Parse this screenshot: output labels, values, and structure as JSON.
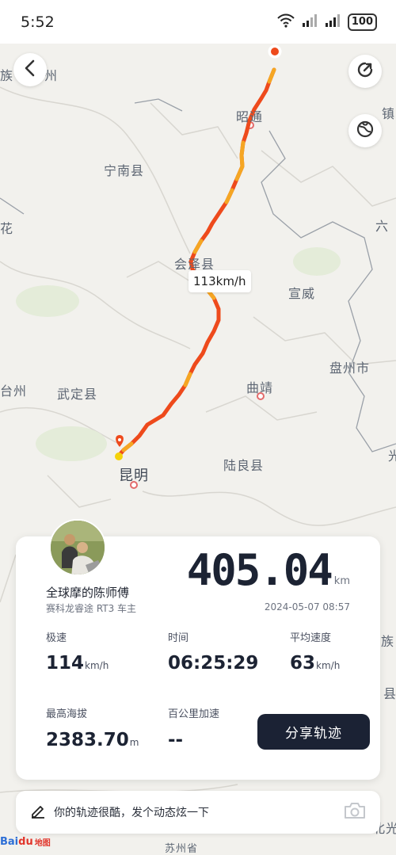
{
  "status_bar": {
    "time": "5:52",
    "battery": "100"
  },
  "map": {
    "labels": [
      {
        "id": "zhaotong",
        "text": "昭通"
      },
      {
        "id": "ningnan",
        "text": "宁南县"
      },
      {
        "id": "huize",
        "text": "会泽县"
      },
      {
        "id": "xuanwei",
        "text": "宣威"
      },
      {
        "id": "qujing",
        "text": "曲靖"
      },
      {
        "id": "panzhou",
        "text": "盘州市"
      },
      {
        "id": "wuding",
        "text": "武定县"
      },
      {
        "id": "kunming",
        "text": "昆明"
      },
      {
        "id": "luliang",
        "text": "陆良县"
      },
      {
        "id": "edge-zu",
        "text": "族"
      },
      {
        "id": "edge-zhou",
        "text": "州"
      },
      {
        "id": "edge-hua",
        "text": "花"
      },
      {
        "id": "edge-zhen",
        "text": "镇"
      },
      {
        "id": "edge-liu",
        "text": "六"
      },
      {
        "id": "edge-tai",
        "text": "台州"
      },
      {
        "id": "edge-guang",
        "text": "光"
      },
      {
        "id": "edge-zu2",
        "text": "族"
      },
      {
        "id": "edge-xian",
        "text": "县"
      },
      {
        "id": "edge-beiguang",
        "text": "北光"
      },
      {
        "id": "edge-suzhou",
        "text": "苏州省"
      }
    ],
    "speed_tag": "113km/h",
    "route_color": "#ee4a1c",
    "route_highlight_color": "#f5a623"
  },
  "card": {
    "user_name": "全球摩的陈师傅",
    "user_sub": "赛科龙睿途 RT3 车主",
    "distance_value": "405.04",
    "distance_unit": "km",
    "date": "2024-05-07 08:57",
    "stats": {
      "top_speed_label": "极速",
      "top_speed_value": "114",
      "top_speed_unit": "km/h",
      "time_label": "时间",
      "time_value": "06:25:29",
      "avg_speed_label": "平均速度",
      "avg_speed_value": "63",
      "avg_speed_unit": "km/h",
      "max_alt_label": "最高海拔",
      "max_alt_value": "2383.70",
      "max_alt_unit": "m",
      "accel_label": "百公里加速",
      "accel_value": "--"
    },
    "share_label": "分享轨迹"
  },
  "post_bar": {
    "text": "你的轨迹很酷，发个动态炫一下"
  },
  "baidu": {
    "bai": "Bai",
    "du": "du",
    "map": "地图"
  },
  "icons": [
    "back-icon",
    "share-route-icon",
    "map-layer-icon",
    "edit-icon",
    "camera-icon",
    "wifi-icon",
    "signal-icon"
  ]
}
